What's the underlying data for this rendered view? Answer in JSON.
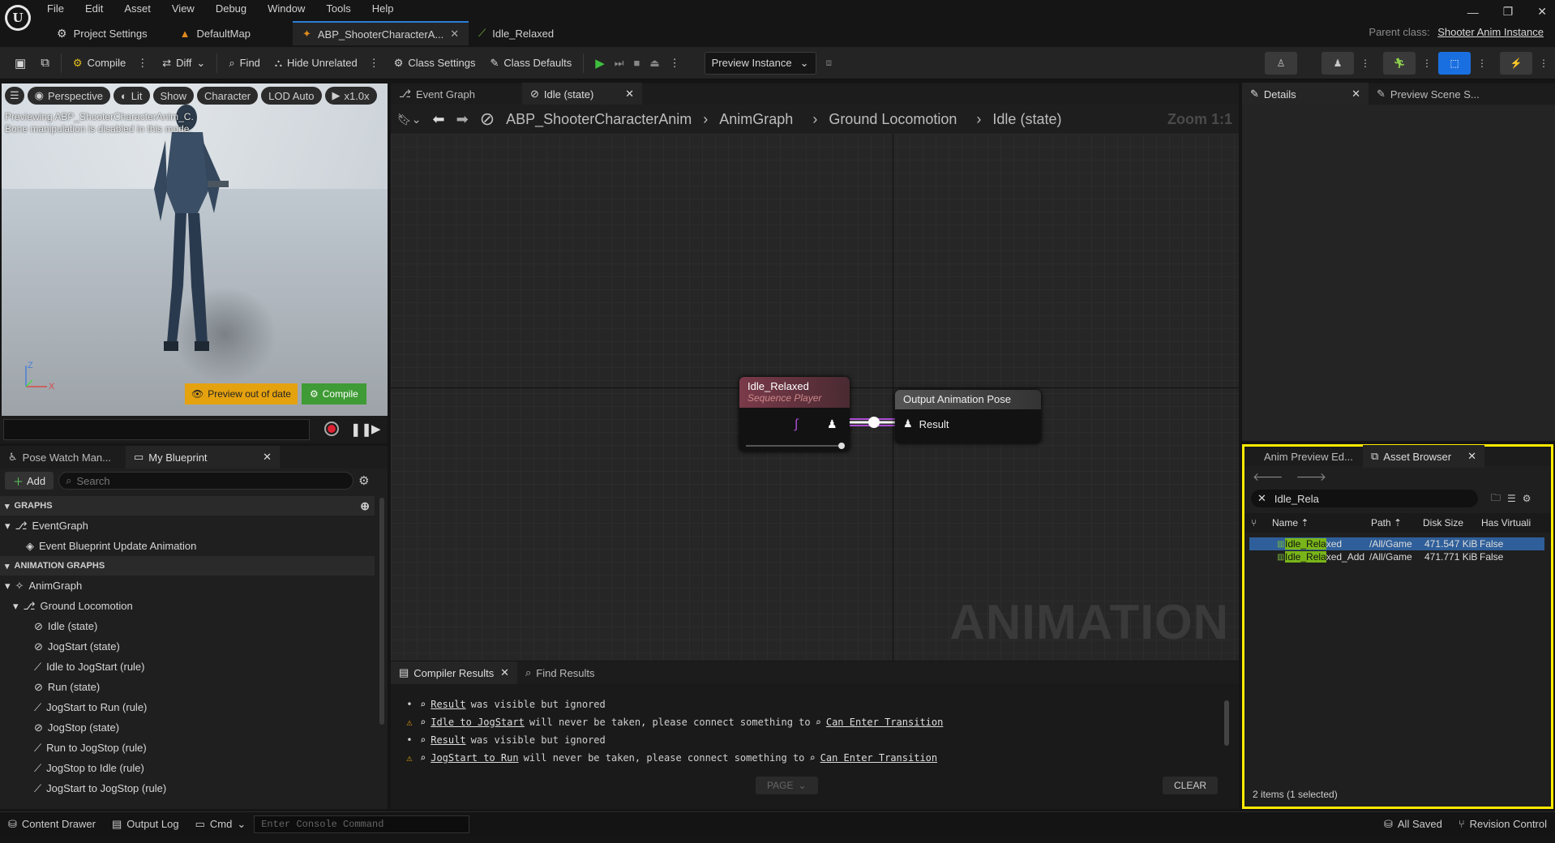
{
  "menu": [
    "File",
    "Edit",
    "Asset",
    "View",
    "Debug",
    "Window",
    "Tools",
    "Help"
  ],
  "doc_tabs": [
    {
      "label": "Project Settings"
    },
    {
      "label": "DefaultMap"
    },
    {
      "label": "ABP_ShooterCharacterA..."
    },
    {
      "label": "Idle_Relaxed"
    }
  ],
  "parent_class": {
    "label": "Parent class:",
    "value": "Shooter Anim Instance"
  },
  "toolbar": {
    "compile": "Compile",
    "diff": "Diff",
    "find": "Find",
    "hide_unrelated": "Hide Unrelated",
    "class_settings": "Class Settings",
    "class_defaults": "Class Defaults",
    "preview_instance": "Preview Instance"
  },
  "viewport": {
    "perspective": "Perspective",
    "lit": "Lit",
    "show": "Show",
    "character": "Character",
    "lod": "LOD Auto",
    "speed": "x1.0x",
    "preview_line1": "Previewing ABP_ShooterCharacterAnim_C.",
    "preview_line2": "Bone manipulation is disabled in this mode.",
    "warning": "Preview out of date",
    "compile": "Compile",
    "axis_z": "Z",
    "axis_x": "X"
  },
  "left_tabs": [
    "Pose Watch Man...",
    "My Blueprint"
  ],
  "my_blueprint": {
    "add": "Add",
    "search_placeholder": "Search",
    "graphs_header": "GRAPHS",
    "event_graph": "EventGraph",
    "event_update": "Event Blueprint Update Animation",
    "anim_graphs_header": "ANIMATION GRAPHS",
    "anim_graph": "AnimGraph",
    "ground_locomotion": "Ground Locomotion",
    "items": [
      "Idle (state)",
      "JogStart (state)",
      "Idle to JogStart (rule)",
      "Run (state)",
      "JogStart to Run (rule)",
      "JogStop (state)",
      "Run to JogStop (rule)",
      "JogStop to Idle (rule)",
      "JogStart to JogStop (rule)"
    ]
  },
  "graph_tabs": [
    "Event Graph",
    "Idle (state)"
  ],
  "breadcrumb": [
    "ABP_ShooterCharacterAnim",
    "AnimGraph",
    "Ground Locomotion",
    "Idle (state)"
  ],
  "zoom": "Zoom 1:1",
  "graph": {
    "node1_title": "Idle_Relaxed",
    "node1_subtitle": "Sequence Player",
    "node2_title": "Output Animation Pose",
    "node2_pin": "Result",
    "watermark": "ANIMATION"
  },
  "compiler_tabs": [
    "Compiler Results",
    "Find Results"
  ],
  "compiler_lines": [
    {
      "type": "info",
      "link": "Result",
      "text": "was visible but ignored",
      "link2": ""
    },
    {
      "type": "warn",
      "link": "Idle to JogStart",
      "text": "will never be taken, please connect something to",
      "link2": "Can Enter Transition"
    },
    {
      "type": "info",
      "link": "Result",
      "text": "was visible but ignored",
      "link2": ""
    },
    {
      "type": "warn",
      "link": "JogStart to Run",
      "text": "will never be taken, please connect something to",
      "link2": "Can Enter Transition"
    }
  ],
  "compiler_page": "PAGE",
  "compiler_clear": "CLEAR",
  "details_tabs": [
    "Details",
    "Preview Scene S..."
  ],
  "asset_browser": {
    "tabs": [
      "Anim Preview Ed...",
      "Asset Browser"
    ],
    "search_value": "Idle_Rela",
    "columns": [
      "Name",
      "Path",
      "Disk Size",
      "Has Virtuali"
    ],
    "rows": [
      {
        "name_hl": "Idle_Rela",
        "name_rest": "xed",
        "path": "/All/Game",
        "size": "471.547 KiB",
        "virtual": "False"
      },
      {
        "name_hl": "Idle_Rela",
        "name_rest": "xed_Add",
        "path": "/All/Game",
        "size": "471.771 KiB",
        "virtual": "False"
      }
    ],
    "footer": "2 items (1 selected)"
  },
  "statusbar": {
    "content_drawer": "Content Drawer",
    "output_log": "Output Log",
    "cmd": "Cmd",
    "console_placeholder": "Enter Console Command",
    "all_saved": "All Saved",
    "revision_control": "Revision Control"
  },
  "colors": {
    "accent": "#2a7bd6",
    "warning": "#e5a20f",
    "compile_green": "#3f9b35",
    "highlight_border": "#ffea00",
    "selection": "#2f5f9a"
  }
}
